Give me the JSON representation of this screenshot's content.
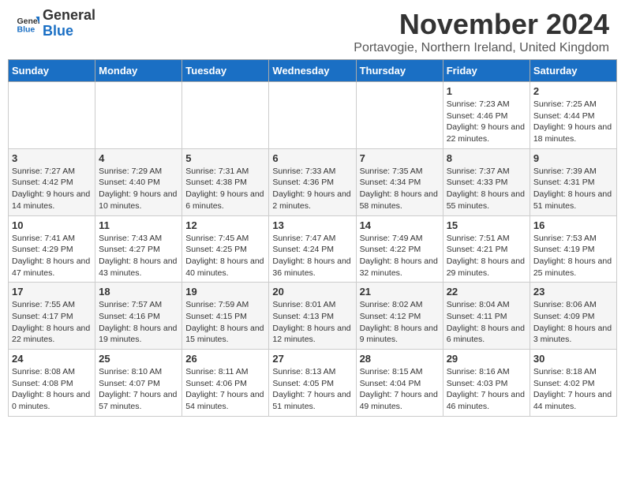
{
  "header": {
    "logo_general": "General",
    "logo_blue": "Blue",
    "month_title": "November 2024",
    "location": "Portavogie, Northern Ireland, United Kingdom"
  },
  "calendar": {
    "days_of_week": [
      "Sunday",
      "Monday",
      "Tuesday",
      "Wednesday",
      "Thursday",
      "Friday",
      "Saturday"
    ],
    "weeks": [
      [
        {
          "day": "",
          "info": ""
        },
        {
          "day": "",
          "info": ""
        },
        {
          "day": "",
          "info": ""
        },
        {
          "day": "",
          "info": ""
        },
        {
          "day": "",
          "info": ""
        },
        {
          "day": "1",
          "info": "Sunrise: 7:23 AM\nSunset: 4:46 PM\nDaylight: 9 hours and 22 minutes."
        },
        {
          "day": "2",
          "info": "Sunrise: 7:25 AM\nSunset: 4:44 PM\nDaylight: 9 hours and 18 minutes."
        }
      ],
      [
        {
          "day": "3",
          "info": "Sunrise: 7:27 AM\nSunset: 4:42 PM\nDaylight: 9 hours and 14 minutes."
        },
        {
          "day": "4",
          "info": "Sunrise: 7:29 AM\nSunset: 4:40 PM\nDaylight: 9 hours and 10 minutes."
        },
        {
          "day": "5",
          "info": "Sunrise: 7:31 AM\nSunset: 4:38 PM\nDaylight: 9 hours and 6 minutes."
        },
        {
          "day": "6",
          "info": "Sunrise: 7:33 AM\nSunset: 4:36 PM\nDaylight: 9 hours and 2 minutes."
        },
        {
          "day": "7",
          "info": "Sunrise: 7:35 AM\nSunset: 4:34 PM\nDaylight: 8 hours and 58 minutes."
        },
        {
          "day": "8",
          "info": "Sunrise: 7:37 AM\nSunset: 4:33 PM\nDaylight: 8 hours and 55 minutes."
        },
        {
          "day": "9",
          "info": "Sunrise: 7:39 AM\nSunset: 4:31 PM\nDaylight: 8 hours and 51 minutes."
        }
      ],
      [
        {
          "day": "10",
          "info": "Sunrise: 7:41 AM\nSunset: 4:29 PM\nDaylight: 8 hours and 47 minutes."
        },
        {
          "day": "11",
          "info": "Sunrise: 7:43 AM\nSunset: 4:27 PM\nDaylight: 8 hours and 43 minutes."
        },
        {
          "day": "12",
          "info": "Sunrise: 7:45 AM\nSunset: 4:25 PM\nDaylight: 8 hours and 40 minutes."
        },
        {
          "day": "13",
          "info": "Sunrise: 7:47 AM\nSunset: 4:24 PM\nDaylight: 8 hours and 36 minutes."
        },
        {
          "day": "14",
          "info": "Sunrise: 7:49 AM\nSunset: 4:22 PM\nDaylight: 8 hours and 32 minutes."
        },
        {
          "day": "15",
          "info": "Sunrise: 7:51 AM\nSunset: 4:21 PM\nDaylight: 8 hours and 29 minutes."
        },
        {
          "day": "16",
          "info": "Sunrise: 7:53 AM\nSunset: 4:19 PM\nDaylight: 8 hours and 25 minutes."
        }
      ],
      [
        {
          "day": "17",
          "info": "Sunrise: 7:55 AM\nSunset: 4:17 PM\nDaylight: 8 hours and 22 minutes."
        },
        {
          "day": "18",
          "info": "Sunrise: 7:57 AM\nSunset: 4:16 PM\nDaylight: 8 hours and 19 minutes."
        },
        {
          "day": "19",
          "info": "Sunrise: 7:59 AM\nSunset: 4:15 PM\nDaylight: 8 hours and 15 minutes."
        },
        {
          "day": "20",
          "info": "Sunrise: 8:01 AM\nSunset: 4:13 PM\nDaylight: 8 hours and 12 minutes."
        },
        {
          "day": "21",
          "info": "Sunrise: 8:02 AM\nSunset: 4:12 PM\nDaylight: 8 hours and 9 minutes."
        },
        {
          "day": "22",
          "info": "Sunrise: 8:04 AM\nSunset: 4:11 PM\nDaylight: 8 hours and 6 minutes."
        },
        {
          "day": "23",
          "info": "Sunrise: 8:06 AM\nSunset: 4:09 PM\nDaylight: 8 hours and 3 minutes."
        }
      ],
      [
        {
          "day": "24",
          "info": "Sunrise: 8:08 AM\nSunset: 4:08 PM\nDaylight: 8 hours and 0 minutes."
        },
        {
          "day": "25",
          "info": "Sunrise: 8:10 AM\nSunset: 4:07 PM\nDaylight: 7 hours and 57 minutes."
        },
        {
          "day": "26",
          "info": "Sunrise: 8:11 AM\nSunset: 4:06 PM\nDaylight: 7 hours and 54 minutes."
        },
        {
          "day": "27",
          "info": "Sunrise: 8:13 AM\nSunset: 4:05 PM\nDaylight: 7 hours and 51 minutes."
        },
        {
          "day": "28",
          "info": "Sunrise: 8:15 AM\nSunset: 4:04 PM\nDaylight: 7 hours and 49 minutes."
        },
        {
          "day": "29",
          "info": "Sunrise: 8:16 AM\nSunset: 4:03 PM\nDaylight: 7 hours and 46 minutes."
        },
        {
          "day": "30",
          "info": "Sunrise: 8:18 AM\nSunset: 4:02 PM\nDaylight: 7 hours and 44 minutes."
        }
      ]
    ]
  }
}
